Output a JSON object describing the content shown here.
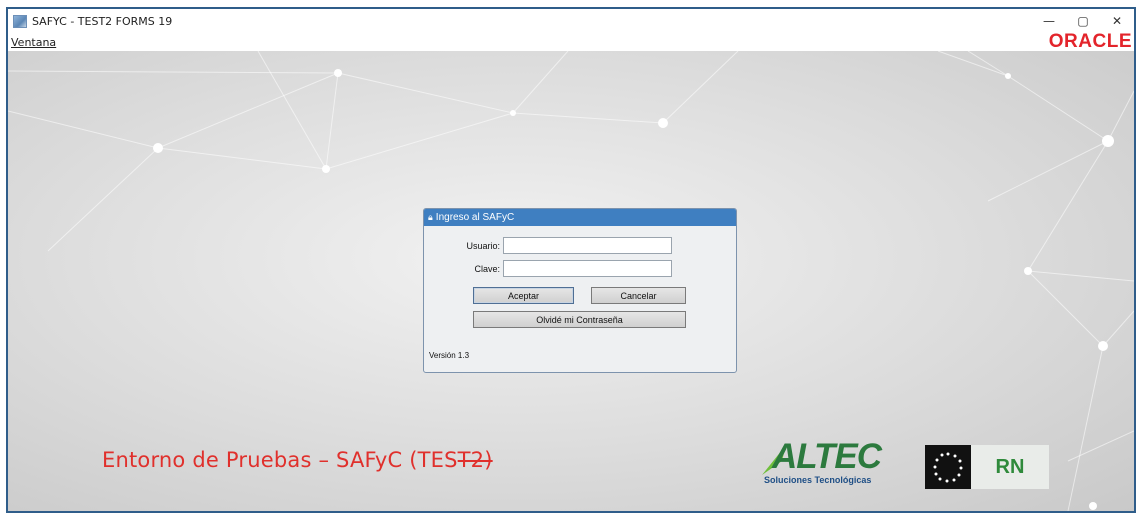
{
  "window": {
    "title": "SAFYC - TEST2 FORMS 19",
    "icon": "java-app-icon",
    "controls": {
      "minimize": "—",
      "restore": "▢",
      "close": "✕"
    }
  },
  "menu": {
    "items": [
      "Ventana"
    ]
  },
  "brand": {
    "oracle": "ORACLE",
    "oracle_color": "#e3242b"
  },
  "login": {
    "title": "Ingreso al SAFyC",
    "title_icon": "lock-icon",
    "user_label": "Usuario:",
    "user_value": "",
    "password_label": "Clave:",
    "password_value": "",
    "accept_label": "Aceptar",
    "cancel_label": "Cancelar",
    "forgot_label": "Olvidé mi Contraseña",
    "version": "Versión 1.3",
    "accent": "#3f7fc1"
  },
  "footer": {
    "env_prefix": "Entorno de Pruebas – SAFyC (TES",
    "env_struck": "T2)",
    "env_color": "#e0302c",
    "altec_name": "ALTEC",
    "altec_tagline": "Soluciones Tecnológicas",
    "rn_label": "RN"
  }
}
